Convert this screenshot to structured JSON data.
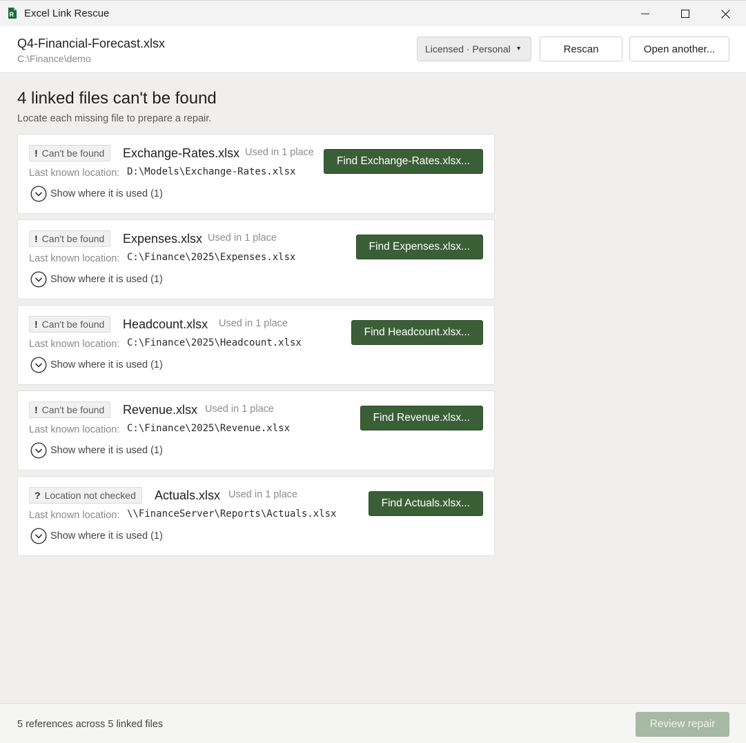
{
  "window": {
    "title": "Excel Link Rescue",
    "icon": "excel-file-icon"
  },
  "header": {
    "file_name": "Q4-Financial-Forecast.xlsx",
    "file_path": "C:\\Finance\\demo",
    "license": "Licensed · Personal",
    "rescan_label": "Rescan",
    "open_another_label": "Open another..."
  },
  "main": {
    "heading": "4 linked files can't be found",
    "subheading": "Locate each missing file to prepare a repair.",
    "location_label": "Last known location:",
    "links": [
      {
        "status_mark": "!",
        "status": "Can't be found",
        "name": "Exchange-Rates.xlsx",
        "used": "Used in 1 place",
        "location": "D:\\Models\\Exchange-Rates.xlsx",
        "toggle": "Show where it is used (1)",
        "action": "Find Exchange-Rates.xlsx..."
      },
      {
        "status_mark": "!",
        "status": "Can't be found",
        "name": "Expenses.xlsx",
        "used": "Used in 1 place",
        "location": "C:\\Finance\\2025\\Expenses.xlsx",
        "toggle": "Show where it is used (1)",
        "action": "Find Expenses.xlsx..."
      },
      {
        "status_mark": "!",
        "status": "Can't be found",
        "name": "Headcount.xlsx",
        "used": "Used in 1 place",
        "location": "C:\\Finance\\2025\\Headcount.xlsx",
        "toggle": "Show where it is used (1)",
        "action": "Find Headcount.xlsx..."
      },
      {
        "status_mark": "!",
        "status": "Can't be found",
        "name": "Revenue.xlsx",
        "used": "Used in 1 place",
        "location": "C:\\Finance\\2025\\Revenue.xlsx",
        "toggle": "Show where it is used (1)",
        "action": "Find Revenue.xlsx..."
      },
      {
        "status_mark": "?",
        "status": "Location not checked",
        "name": "Actuals.xlsx",
        "used": "Used in 1 place",
        "location": "\\\\FinanceServer\\Reports\\Actuals.xlsx",
        "toggle": "Show where it is used (1)",
        "action": "Find Actuals.xlsx..."
      }
    ]
  },
  "footer": {
    "summary": "5 references across 5 linked files",
    "review_label": "Review repair"
  },
  "colors": {
    "accent": "#3a5f36",
    "accent_disabled": "#a6b9a3",
    "background": "#f0efed"
  }
}
